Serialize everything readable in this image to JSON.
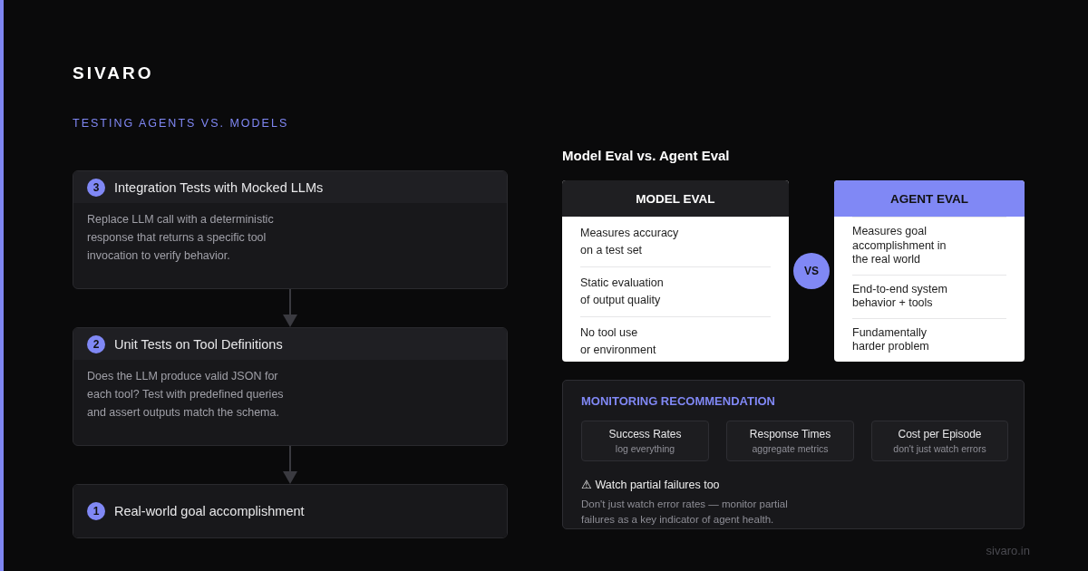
{
  "brand": "SIVARO",
  "section_label": "TESTING AGENTS VS. MODELS",
  "steps": [
    {
      "number": "3",
      "title": "Integration Tests with Mocked LLMs",
      "description": "Replace LLM call with a deterministic\nresponse that returns a specific tool\ninvocation to verify behavior."
    },
    {
      "number": "2",
      "title": "Unit Tests on Tool Definitions",
      "description": "Does the LLM produce valid JSON for\neach tool? Test with predefined queries\nand assert outputs match the schema."
    },
    {
      "number": "1",
      "title": "Real-world goal accomplishment"
    }
  ],
  "comparison": {
    "title": "Model Eval vs. Agent Eval",
    "vs": "VS",
    "cards": [
      {
        "title": "MODEL EVAL",
        "highlighted": false,
        "items": [
          "Measures accuracy\non a test set",
          "Static evaluation\nof output quality",
          "No tool use\nor environment"
        ]
      },
      {
        "title": "AGENT EVAL",
        "highlighted": true,
        "items": [
          "Measures goal\naccomplishment in\nthe real world",
          "End-to-end system\nbehavior + tools",
          "Fundamentally\nharder problem"
        ]
      }
    ]
  },
  "monitoring": {
    "title": "MONITORING RECOMMENDATION",
    "metrics": [
      {
        "name": "Success Rates",
        "note": "log everything"
      },
      {
        "name": "Response Times",
        "note": "aggregate metrics"
      },
      {
        "name": "Cost per Episode",
        "note": "don't just watch errors"
      }
    ],
    "warning": "⚠ Watch partial failures too",
    "warning_text": "Don't just watch error rates — monitor partial\nfailures as a key indicator of agent health."
  },
  "footer": "sivaro.in"
}
